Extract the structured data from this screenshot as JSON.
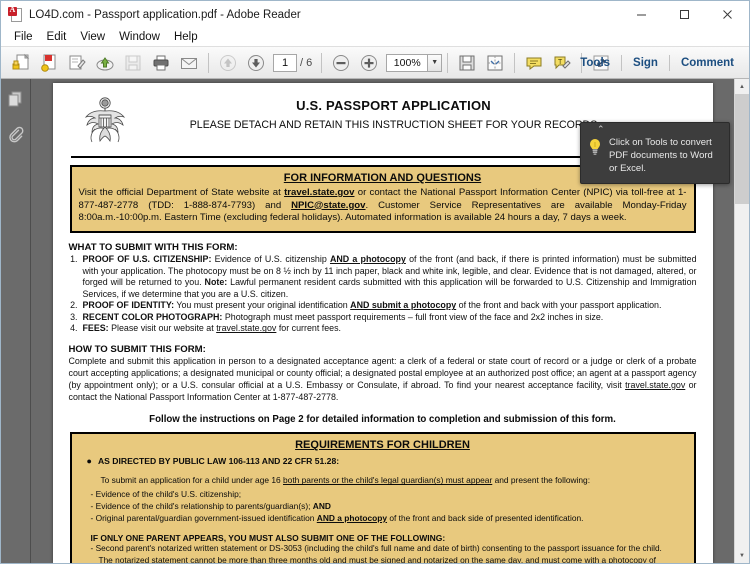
{
  "window": {
    "title": "LO4D.com - Passport application.pdf - Adobe Reader",
    "app_icon": "adobe-reader-icon",
    "minimize_label": "Minimize",
    "maximize_label": "Maximize",
    "close_label": "Close"
  },
  "menubar": {
    "items": [
      {
        "label": "File",
        "name": "menu-file"
      },
      {
        "label": "Edit",
        "name": "menu-edit"
      },
      {
        "label": "View",
        "name": "menu-view"
      },
      {
        "label": "Window",
        "name": "menu-window"
      },
      {
        "label": "Help",
        "name": "menu-help"
      }
    ]
  },
  "toolbar": {
    "open_tip": "Open",
    "create_tip": "Create PDF",
    "edit_tip": "Edit PDF",
    "cloud_tip": "Send files to cloud",
    "save_tip": "Save",
    "print_tip": "Print File",
    "email_tip": "Email File",
    "prev_page_tip": "Previous Page",
    "next_page_tip": "Next Page",
    "page_value": "1",
    "page_total": "/ 6",
    "zoom_out_tip": "Zoom Out",
    "zoom_in_tip": "Zoom In",
    "zoom_value": "100%",
    "zoom_caret": "▼",
    "save_file_tip": "Save File",
    "fit_page_tip": "Fit Page",
    "comment_tip": "Add Sticky Note",
    "highlight_tip": "Highlight Text",
    "fullscreen_tip": "Read Mode",
    "right_items": [
      {
        "label": "Tools",
        "name": "tools-pane-button"
      },
      {
        "label": "Sign",
        "name": "sign-pane-button"
      },
      {
        "label": "Comment",
        "name": "comment-pane-button"
      }
    ]
  },
  "nav_rail": {
    "thumbnails_tip": "Page Thumbnails",
    "attachments_tip": "Attachments"
  },
  "callout": {
    "text": "Click on Tools to convert PDF documents to Word or Excel.",
    "arrow": "⌃",
    "icon": "lightbulb-icon"
  },
  "scrollbar": {
    "up_arrow": "▲",
    "down_arrow": "▼"
  },
  "document": {
    "seal_alt": "great-seal-of-the-united-states",
    "title": "U.S. PASSPORT APPLICATION",
    "subtitle": "PLEASE DETACH AND RETAIN THIS INSTRUCTION SHEET FOR YOUR RECORDS",
    "info_box": {
      "heading": "FOR INFORMATION AND QUESTIONS",
      "body_pre": "Visit the official Department of State website at ",
      "link1": "travel.state.gov",
      "body_mid1": " or contact the National Passport Information Center (NPIC) via toll-free at 1-877-487-2778 (TDD: 1-888-874-7793) and ",
      "link2": "NPIC@state.gov",
      "body_end": ".  Customer Service Representatives are available Monday-Friday 8:00a.m.-10:00p.m. Eastern Time (excluding federal holidays). Automated information is available 24 hours a day, 7 days a week."
    },
    "what_to_submit": {
      "heading": "WHAT TO SUBMIT WITH THIS FORM:",
      "items": [
        {
          "num": "1.",
          "bold_lead": "PROOF OF U.S. CITIZENSHIP:",
          "pre": " Evidence of U.S. citizenship ",
          "underline": "AND a photocopy",
          "post": " of the front (and back, if there is printed information) must be submitted with your application. The photocopy must be on 8 ½ inch by 11 inch paper, black and white ink, legible, and clear. Evidence that is not damaged, altered, or forged will be returned to you. ",
          "note_label": "Note:",
          "note_text": " Lawful permanent resident cards submitted with this application will be forwarded to U.S. Citizenship and Immigration Services, if we determine that you are a U.S. citizen."
        },
        {
          "num": "2.",
          "bold_lead": "PROOF OF IDENTITY:",
          "pre": " You must present your original identification ",
          "underline": "AND submit a photocopy",
          "post": " of the front and back with your passport application.",
          "note_label": "",
          "note_text": ""
        },
        {
          "num": "3.",
          "bold_lead": "RECENT COLOR PHOTOGRAPH:",
          "pre": " Photograph must meet passport requirements – full front view of the face and 2x2 inches in size.",
          "underline": "",
          "post": "",
          "note_label": "",
          "note_text": ""
        },
        {
          "num": "4.",
          "bold_lead": "FEES:",
          "pre": " Please visit our website at ",
          "underline": "travel.state.gov",
          "post": " for current fees.",
          "note_label": "",
          "note_text": ""
        }
      ]
    },
    "how_to_submit": {
      "heading": "HOW TO SUBMIT THIS FORM:",
      "pre": "Complete and submit this application in person to a designated acceptance agent:  a clerk of a federal or state court of record or a judge or clerk of a probate court accepting applications; a designated municipal or county official; a designated postal employee at an authorized post office; an agent at a passport agency (by appointment only); or a U.S. consular official at a U.S. Embassy or Consulate, if abroad.  To find your nearest acceptance facility, visit ",
      "link": "travel.state.gov",
      "post": " or contact the National Passport Information Center at 1-877-487-2778."
    },
    "follow_instructions": "Follow the instructions on Page 2 for detailed information to completion and submission of this form.",
    "children_box": {
      "heading": "REQUIREMENTS FOR CHILDREN",
      "bullet": "AS DIRECTED BY PUBLIC LAW 106-113 AND 22 CFR 51.28:",
      "lead_pre": "To submit an application for a child under age 16 ",
      "lead_underline": "both parents or the child's legal guardian(s) must appear",
      "lead_post": " and present the following:",
      "dashes": [
        {
          "pre": "- Evidence of the child's U.S. citizenship;",
          "underline": "",
          "post": ""
        },
        {
          "pre": "- Evidence of the child's relationship to parents/guardian(s); ",
          "underline": "",
          "post": "AND",
          "bold_post": true
        },
        {
          "pre": "- Original parental/guardian government-issued identification ",
          "underline": "AND a photocopy",
          "post": " of the front and back side of presented identification."
        }
      ],
      "one_parent_heading": "IF ONLY ONE PARENT APPEARS, YOU MUST ALSO SUBMIT ONE OF THE FOLLOWING:",
      "one_parent_lines": [
        "-  Second parent's notarized written statement or DS-3053 (including the child's full name and date of birth) consenting to the passport issuance for the child.",
        "The notarized statement cannot be more than three months old and must be signed and notarized on the same day, and must come with a photocopy of"
      ]
    }
  },
  "colors": {
    "gold_box": "#e8c97e",
    "toolbar_accent": "#1c4e80",
    "callout_bg": "#3d3d3d",
    "doc_background": "#6a6a6a"
  }
}
